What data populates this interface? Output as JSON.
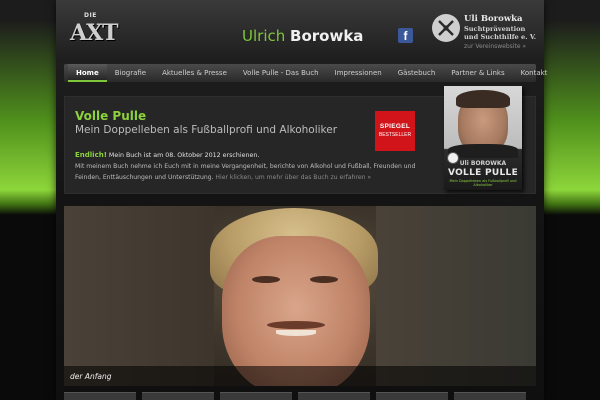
{
  "header": {
    "logo": {
      "small": "DIE",
      "big": "AXT"
    },
    "title_first": "Ulrich",
    "title_last": "Borowka",
    "facebook_icon": "facebook-icon",
    "org": {
      "name": "Uli Borowka",
      "line1": "Suchtprävention",
      "line2": "und Suchthilfe e. V.",
      "link": "zur Vereinswebsite »"
    }
  },
  "nav": {
    "items": [
      {
        "label": "Home",
        "active": true
      },
      {
        "label": "Biografie"
      },
      {
        "label": "Aktuelles & Presse"
      },
      {
        "label": "Volle Pulle - Das Buch"
      },
      {
        "label": "Impressionen"
      },
      {
        "label": "Gästebuch"
      },
      {
        "label": "Partner & Links"
      },
      {
        "label": "Kontakt"
      }
    ]
  },
  "promo": {
    "heading": "Volle Pulle",
    "subtitle": "Mein Doppelleben als Fußballprofi und Alkoholiker",
    "highlight": "Endlich!",
    "line1": " Mein Buch ist am 08. Oktober 2012 erschienen.",
    "line2": "Mit meinem Buch nehme ich Euch mit in meine Vergangenheit, berichte von Alkohol und Fußball, Freunden und",
    "line3": "Feinden, Enttäuschungen und Unterstützung.",
    "more": " Hier klicken, um mehr über das Buch zu erfahren »",
    "badge_line1": "SPIEGEL",
    "badge_line2": "BESTSELLER"
  },
  "book": {
    "author": "Uli BOROWKA",
    "title": "VOLLE PULLE",
    "small": "Mein Doppelleben als Fußballprofi und Alkoholiker"
  },
  "hero": {
    "caption": "der Anfang"
  },
  "colors": {
    "accent_green": "#8cd23c",
    "background_dark": "#141414",
    "spiegel_red": "#d0141a",
    "facebook_blue": "#3b5998"
  }
}
